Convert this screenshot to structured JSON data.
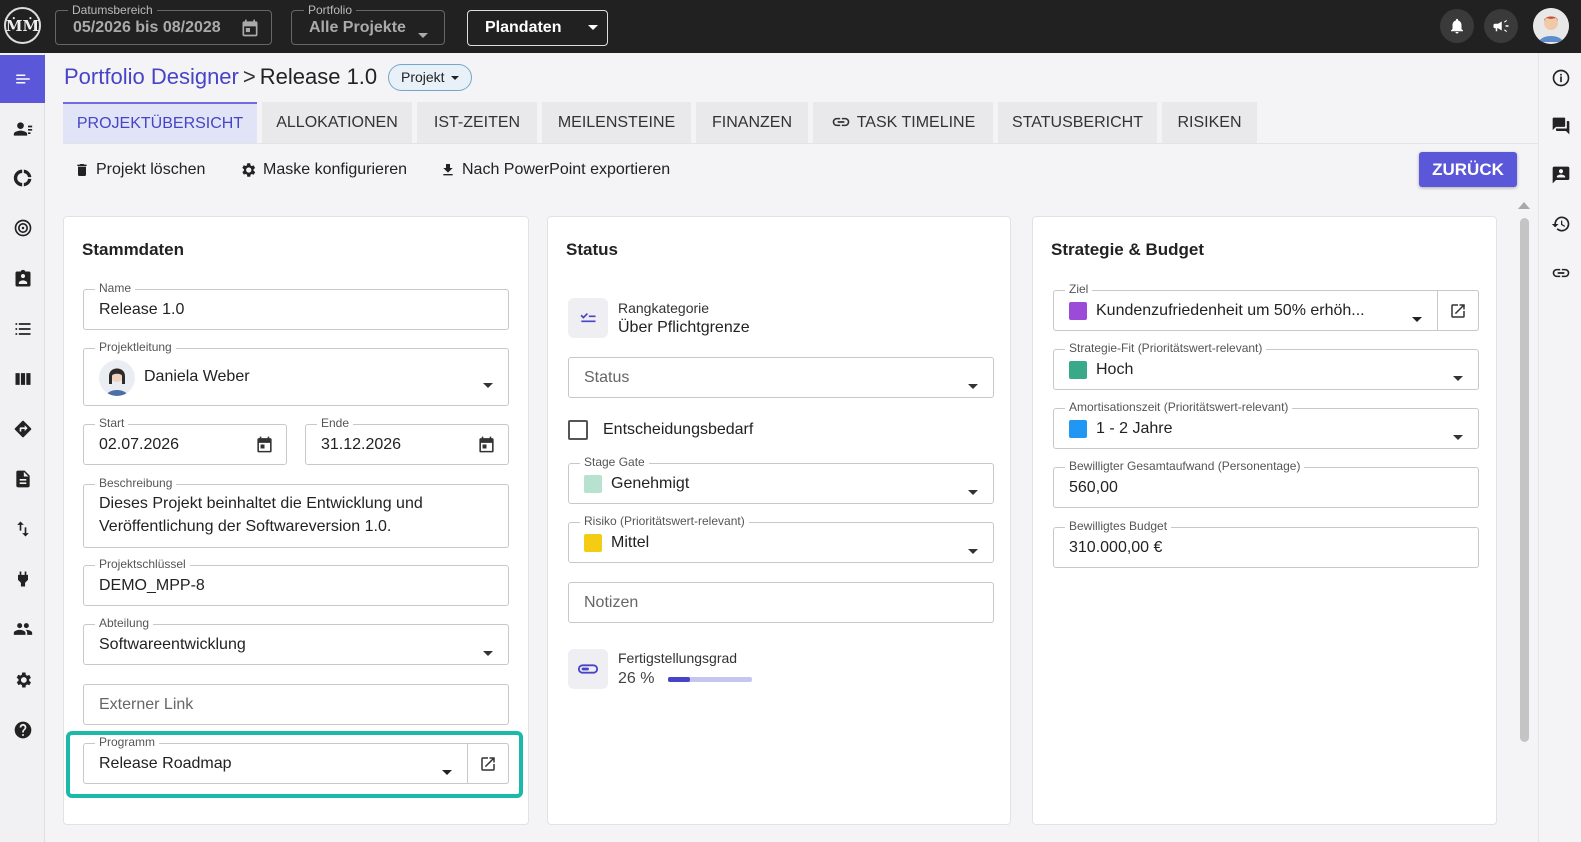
{
  "topbar": {
    "date_range_label": "Datumsbereich",
    "date_range_value": "05/2026 bis 08/2028",
    "portfolio_label": "Portfolio",
    "portfolio_value": "Alle Projekte",
    "plandaten": "Plandaten"
  },
  "breadcrumb": {
    "root": "Portfolio Designer",
    "separator": ">",
    "current": "Release 1.0",
    "chip": "Projekt"
  },
  "tabs": [
    "PROJEKTÜBERSICHT",
    "ALLOKATIONEN",
    "IST-ZEITEN",
    "MEILENSTEINE",
    "FINANZEN",
    "TASK TIMELINE",
    "STATUSBERICHT",
    "RISIKEN"
  ],
  "actions": {
    "delete": "Projekt löschen",
    "configure": "Maske konfigurieren",
    "export": "Nach PowerPoint exportieren",
    "back": "ZURÜCK"
  },
  "stammdaten": {
    "title": "Stammdaten",
    "name_label": "Name",
    "name_value": "Release 1.0",
    "lead_label": "Projektleitung",
    "lead_value": "Daniela Weber",
    "start_label": "Start",
    "start_value": "02.07.2026",
    "end_label": "Ende",
    "end_value": "31.12.2026",
    "desc_label": "Beschreibung",
    "desc_line1": "Dieses Projekt beinhaltet die Entwicklung und",
    "desc_line2": "Veröffentlichung der Softwareversion 1.0.",
    "key_label": "Projektschlüssel",
    "key_value": "DEMO_MPP-8",
    "dept_label": "Abteilung",
    "dept_value": "Softwareentwicklung",
    "link_placeholder": "Externer Link",
    "program_label": "Programm",
    "program_value": "Release Roadmap"
  },
  "status": {
    "title": "Status",
    "rank_label": "Rangkategorie",
    "rank_value": "Über Pflichtgrenze",
    "status_placeholder": "Status",
    "decision_label": "Entscheidungsbedarf",
    "stage_label": "Stage Gate",
    "stage_value": "Genehmigt",
    "stage_color": "#b6e2cf",
    "risk_label": "Risiko (Prioritätswert-relevant)",
    "risk_value": "Mittel",
    "risk_color": "#f5cc14",
    "notes_placeholder": "Notizen",
    "completion_label": "Fertigstellungsgrad",
    "completion_value": "26 %",
    "completion_fraction": 0.26
  },
  "strategy": {
    "title": "Strategie & Budget",
    "goal_label": "Ziel",
    "goal_value": "Kundenzufriedenheit um 50% erhöh...",
    "goal_color": "#9b4bd8",
    "fit_label": "Strategie-Fit (Prioritätswert-relevant)",
    "fit_value": "Hoch",
    "fit_color": "#3aa98a",
    "amort_label": "Amortisationszeit (Prioritätswert-relevant)",
    "amort_value": "1 - 2 Jahre",
    "amort_color": "#2196f3",
    "effort_label": "Bewilligter Gesamtaufwand (Personentage)",
    "effort_value": "560,00",
    "budget_label": "Bewilligtes Budget",
    "budget_value": "310.000,00 €"
  },
  "colors": {
    "accent": "#5a57d8",
    "highlight": "#1bb9a9",
    "topbar": "#212121"
  }
}
